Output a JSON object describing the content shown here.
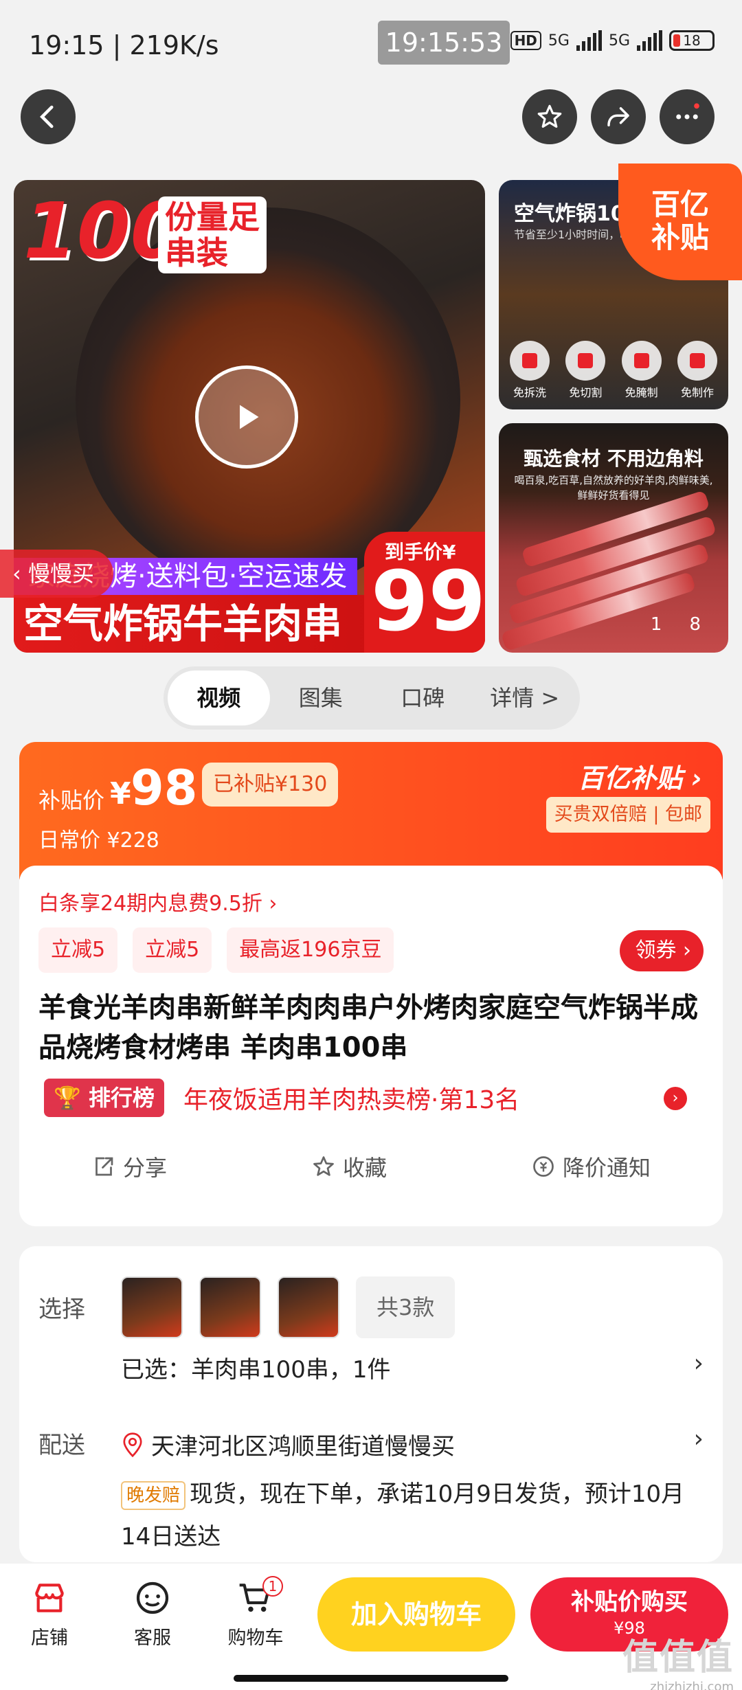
{
  "status": {
    "time": "19:15 | 219K/s",
    "clock": "19:15:53",
    "network_hd": "HD",
    "net1": "5G",
    "net2": "5G",
    "battery": "18"
  },
  "gallery": {
    "promo_big": "100",
    "promo_side": "份量足\n串装",
    "band_purple": "家庭烧烤·送料包·空运速发",
    "band_red": "空气炸锅牛羊肉串",
    "price_label": "到手价¥",
    "price": "99",
    "slow_tag": "慢慢买",
    "side1_title": "空气炸锅10分",
    "side1_sub": "节省至少1小时时间，吃一口",
    "side1_icons": [
      "免拆洗",
      "免切割",
      "免腌制",
      "免制作"
    ],
    "subsidy_corner": "百亿\n补贴",
    "side2_title": "甄选食材 不用边角料",
    "side2_sub": "喝百泉,吃百草,自然放养的好羊肉,肉鲜味美,鲜鲜好货看得见",
    "pager_current": "1",
    "pager_total": "8"
  },
  "tabs": [
    "视频",
    "图集",
    "口碑",
    "详情 >"
  ],
  "price": {
    "label": "补贴价",
    "yen": "¥",
    "value": "98",
    "subsidy": "已补贴¥130",
    "daily": "日常价 ¥228",
    "brand": "百亿补贴 ›",
    "guarantee": "买贵双倍赔 | 包邮"
  },
  "body": {
    "installment": "白条享24期内息费9.5折 ›",
    "coupons": [
      "立减5",
      "立减5",
      "最高返196京豆"
    ],
    "get_coupon": "领券 ›",
    "title": "羊食光羊肉串新鲜羊肉肉串户外烤肉家庭空气炸锅半成品烧烤食材烤串 羊肉串100串",
    "rank_badge": "排行榜",
    "rank_text": "年夜饭适用羊肉热卖榜·第13名",
    "actions": [
      "分享",
      "收藏",
      "降价通知"
    ]
  },
  "select": {
    "label_select": "选择",
    "total": "共3款",
    "chosen": "已选：羊肉串100串，1件",
    "label_ship": "配送",
    "address": "天津河北区鸿顺里街道慢慢买",
    "late_tag": "晚发赔",
    "ship_text": "现货，现在下单，承诺10月9日发货，预计10月14日送达"
  },
  "bottom": {
    "shop": "店铺",
    "service": "客服",
    "cart": "购物车",
    "cart_count": "1",
    "add_cart": "加入购物车",
    "buy": "补贴价购买",
    "buy_price": "¥98"
  },
  "watermark": {
    "logo": "值值值",
    "site": "zhizhizhi.com"
  },
  "colors": {
    "accent_red": "#e8222a",
    "subsidy_orange": "#ff5a1e",
    "cart_yellow": "#ffd21f"
  }
}
